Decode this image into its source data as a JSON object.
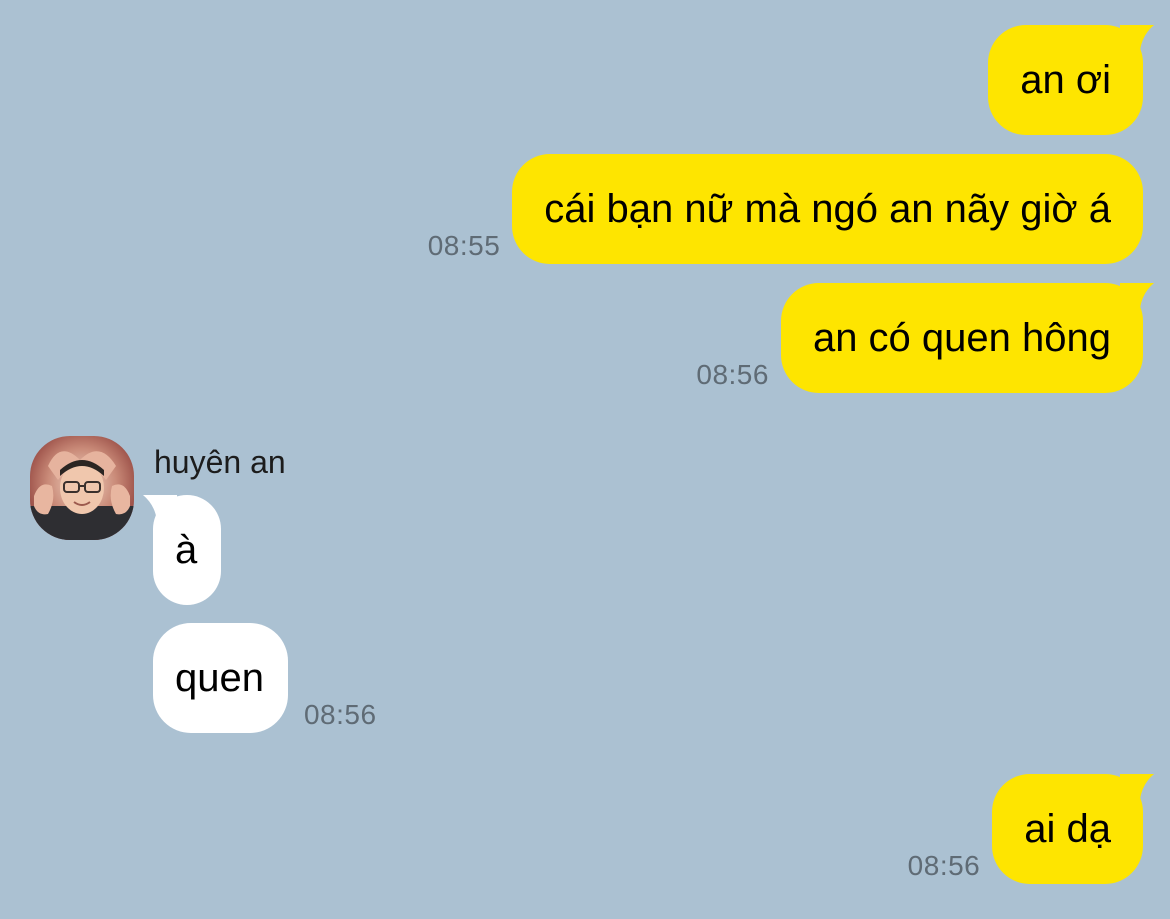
{
  "conversation": {
    "contact_name": "huyên an",
    "messages": [
      {
        "direction": "out",
        "text": "an ơi",
        "time": ""
      },
      {
        "direction": "out",
        "text": "cái bạn nữ mà ngó an nãy giờ á",
        "time": "08:55"
      },
      {
        "direction": "out",
        "text": "an có quen hông",
        "time": "08:56"
      },
      {
        "direction": "in",
        "text": "à",
        "time": ""
      },
      {
        "direction": "in",
        "text": "quen",
        "time": "08:56"
      },
      {
        "direction": "out",
        "text": "ai dạ",
        "time": "08:56"
      }
    ]
  },
  "colors": {
    "background": "#abc1d2",
    "outgoing_bubble": "#fee500",
    "incoming_bubble": "#ffffff",
    "timestamp": "#5f6b75"
  },
  "icons": {
    "avatar": "profile-photo-heart-hands"
  }
}
